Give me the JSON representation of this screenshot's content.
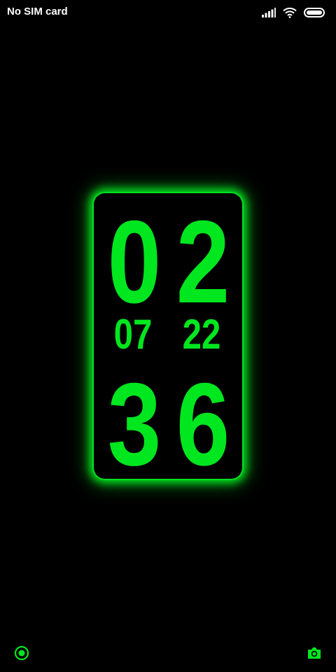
{
  "status_bar": {
    "carrier": "No SIM card",
    "icons": [
      "signal-icon",
      "wifi-icon",
      "battery-icon"
    ]
  },
  "clock": {
    "hour_tens": "0",
    "hour_ones": "2",
    "month": "07",
    "day": "22",
    "minute_tens": "3",
    "minute_ones": "6"
  },
  "controls": {
    "left_icon": "target-icon",
    "right_icon": "camera-icon"
  },
  "colors": {
    "background": "#000000",
    "digits": "#00e61f",
    "glow": "#00e01e",
    "status_text": "#ffffff"
  }
}
